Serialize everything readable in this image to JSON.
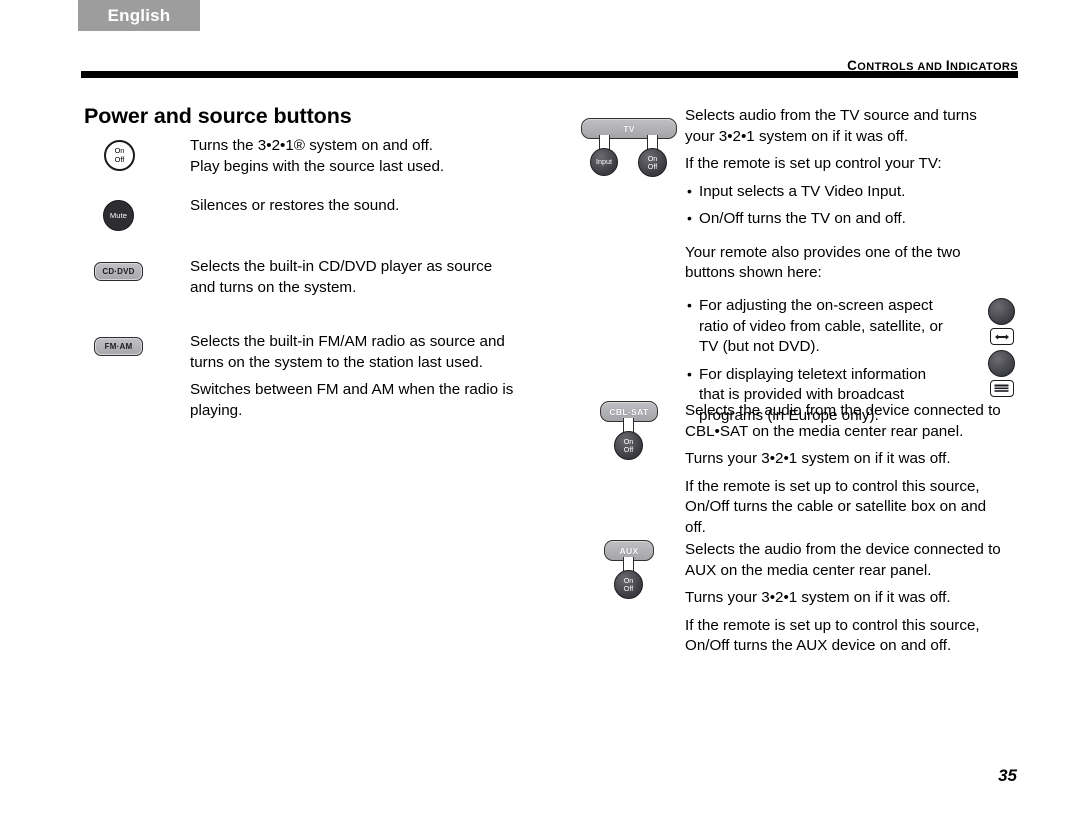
{
  "header": {
    "language_tab": "English",
    "running_head_first": "C",
    "running_head_rest_1": "ONTROLS",
    "running_head_and": "AND",
    "running_head_first_2": "I",
    "running_head_rest_2": "NDICATORS",
    "running_head_full": "CONTROLS AND INDICATORS"
  },
  "page_title": "Power and source buttons",
  "folio": "35",
  "colors": {
    "tab_gray": "#9d9d9d",
    "rule_black": "#000000",
    "button_gray": "#b4b4b8",
    "knob_dark": "#3a3a41",
    "text": "#000000"
  },
  "left_column": [
    {
      "icon": {
        "type": "circle-outline",
        "line1": "On",
        "line2": "Off",
        "name": "on-off-button"
      },
      "paragraphs": [
        "Turns the 3•2•1® system on and off.",
        "Play begins with the source last used."
      ]
    },
    {
      "icon": {
        "type": "circle-dark",
        "label": "Mute",
        "name": "mute-button"
      },
      "paragraphs": [
        "Silences or restores the sound."
      ]
    },
    {
      "icon": {
        "type": "pill",
        "label": "CD·DVD",
        "name": "cd-dvd-button"
      },
      "paragraphs": [
        "Selects the built-in CD/DVD player as source and turns on the system."
      ]
    },
    {
      "icon": {
        "type": "pill",
        "label": "FM·AM",
        "name": "fm-am-button"
      },
      "paragraphs": [
        "Selects the built-in FM/AM radio as source and turns on the system to the station last used.",
        "Switches between FM and AM when the radio is playing."
      ]
    }
  ],
  "right_column": {
    "tv_group": {
      "bar_label": "TV",
      "knob_input_label": "Input",
      "knob_onoff_line1": "On",
      "knob_onoff_line2": "Off",
      "paragraphs": [
        "Selects audio from the TV source and turns your 3•2•1 system on if it was off.",
        "If the remote is set up control your TV:"
      ],
      "bullets": [
        "Input selects a TV Video Input.",
        "On/Off turns the TV on and off."
      ],
      "followup": "Your remote also provides one of the two buttons shown here:",
      "option_bullets": [
        "For adjusting the on-screen aspect ratio of video from cable, satellite, or TV (but not DVD).",
        "For displaying teletext information that is provided with broadcast programs (in Europe only)."
      ],
      "option_icons": [
        {
          "name": "aspect-ratio-button",
          "glyph": "double-arrow-horizontal-icon"
        },
        {
          "name": "teletext-button",
          "glyph": "teletext-lines-icon"
        }
      ]
    },
    "cbl_sat_group": {
      "bar_label": "CBL·SAT",
      "knob_onoff_line1": "On",
      "knob_onoff_line2": "Off",
      "paragraphs": [
        "Selects the audio from the device connected to CBL•SAT on the media center rear panel.",
        "Turns your 3•2•1 system on if it was off.",
        "If the remote is set up to control this source, On/Off turns the cable or satellite box on and off."
      ]
    },
    "aux_group": {
      "bar_label": "AUX",
      "knob_onoff_line1": "On",
      "knob_onoff_line2": "Off",
      "paragraphs": [
        "Selects the audio from the device connected to AUX on the media center rear panel.",
        "Turns your 3•2•1 system on if it was off.",
        "If the remote is set up to control this source, On/Off turns the AUX device on and off."
      ]
    }
  }
}
